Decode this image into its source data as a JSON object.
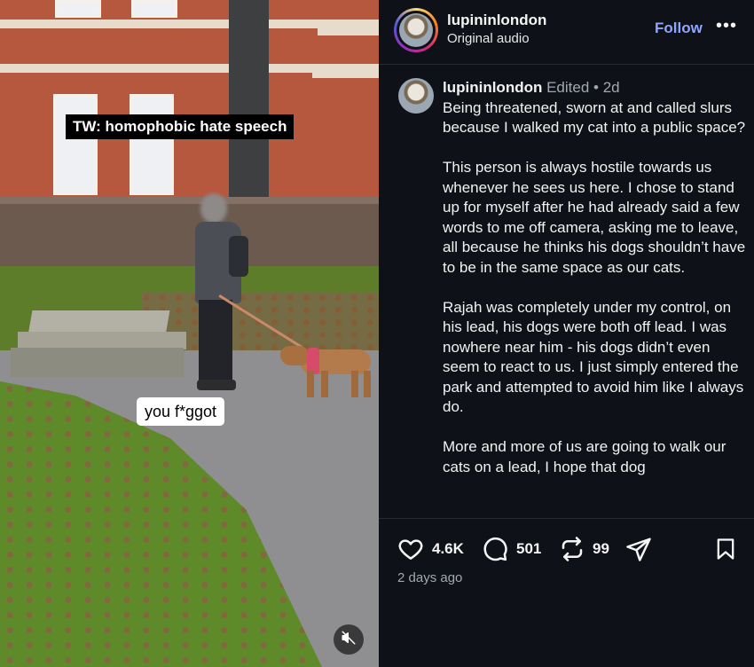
{
  "video": {
    "overlay_title": "TW: homophobic hate speech",
    "caption": "you f*ggot",
    "mute_icon": "speaker-muted-icon"
  },
  "header": {
    "username": "lupininlondon",
    "audio": "Original audio",
    "follow_label": "Follow",
    "more_label": "•••"
  },
  "post": {
    "username": "lupininlondon",
    "meta": "Edited • 2d",
    "paragraphs": [
      "Being threatened, sworn at and called slurs because I walked my cat into a public space?",
      "This person is always hostile towards us whenever he sees us here. I chose to stand up for myself after he had already said a few words to me off camera, asking me to leave, all because he thinks his dogs shouldn’t have to be in the same space as our cats.",
      "Rajah was completely under my control, on his lead, his dogs were both off lead. I was nowhere near him - his dogs didn’t even seem to react to us. I just simply entered the park and attempted to avoid him like I always do.",
      "More and more of us are going to walk our cats on a lead, I hope that dog"
    ]
  },
  "actions": {
    "likes": "4.6K",
    "comments": "501",
    "reposts": "99",
    "posted_ago": "2 days ago"
  },
  "colors": {
    "panel_bg": "#0e1117",
    "follow_blue": "#8fa6ff",
    "muted_text": "#a3a8b0"
  }
}
